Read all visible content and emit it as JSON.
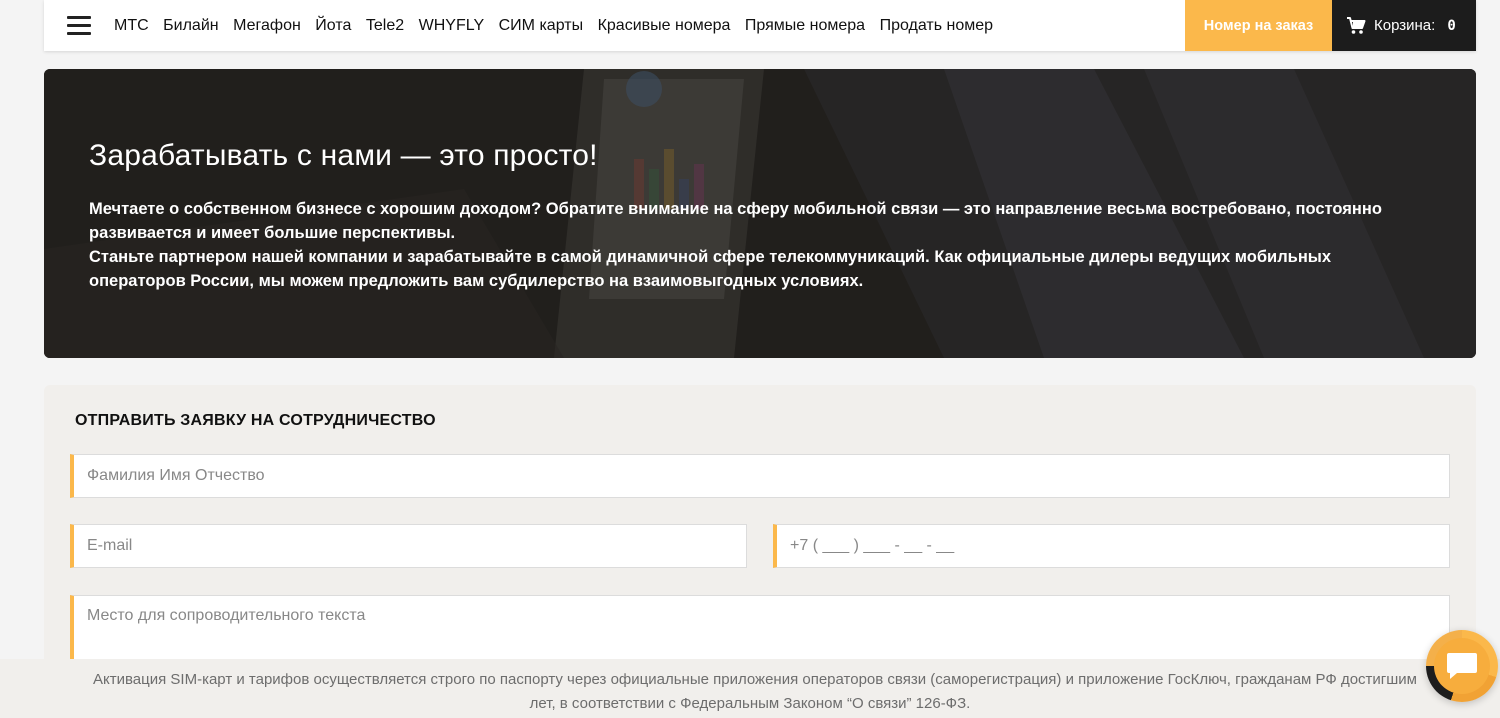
{
  "header": {
    "menu_icon": "hamburger-icon",
    "nav": [
      "МТС",
      "Билайн",
      "Мегафон",
      "Йота",
      "Tele2",
      "WHYFLY",
      "СИМ карты",
      "Красивые номера",
      "Прямые номера",
      "Продать номер"
    ],
    "order_button": "Номер на заказ",
    "cart": {
      "icon": "cart-icon",
      "label": "Корзина:",
      "count": "0"
    }
  },
  "hero": {
    "title": "Зарабатывать с нами — это просто!",
    "paragraph1": "Мечтаете о собственном бизнесе с хорошим доходом? Обратите внимание на сферу мобильной связи — это направление весьма востребовано, постоянно развивается и имеет большие перспективы.",
    "paragraph2": "Станьте партнером нашей компании и зарабатывайте в самой динамичной сфере телекоммуникаций. Как официальные дилеры ведущих мобильных операторов России, мы можем предложить вам субдилерство на взаимовыгодных условиях."
  },
  "form": {
    "title": "ОТПРАВИТЬ ЗАЯВКУ НА СОТРУДНИЧЕСТВО",
    "name_placeholder": "Фамилия Имя Отчество",
    "email_placeholder": "E-mail",
    "phone_placeholder": "+7 ( ___ ) ___ - __ - __",
    "message_placeholder": "Место для сопроводительного текста"
  },
  "footer": {
    "line1": "Активация SIM-карт и тарифов осуществляется строго по паспорту через официальные приложения операторов связи (саморегистрация) и приложение ГосКлюч, гражданам РФ достигшим",
    "line2": "лет, в соответствии с Федеральным Законом “О связи” 126-ФЗ."
  },
  "chat": {
    "icon": "chat-bubble-icon"
  },
  "colors": {
    "accent": "#fbb84b",
    "dark": "#1c1c1c",
    "form_bg": "#f1efec"
  }
}
